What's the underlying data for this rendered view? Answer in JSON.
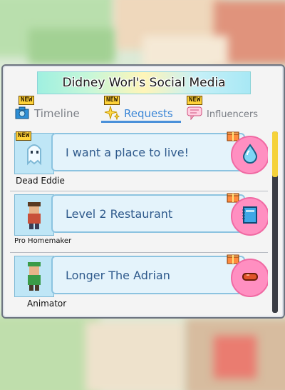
{
  "panel": {
    "title": "Didney Worl's Social Media"
  },
  "tabs": [
    {
      "label": "Timeline",
      "icon": "camera-icon",
      "new": "NEW",
      "active": false
    },
    {
      "label": "Requests",
      "icon": "sparkle-icon",
      "new": "NEW",
      "active": true
    },
    {
      "label": "Influencers",
      "icon": "speech-bubble-icon",
      "new": "NEW",
      "active": false
    }
  ],
  "requests": [
    {
      "name": "Dead Eddie",
      "text": "I want a place to live!",
      "new": "NEW",
      "reward_icon": "water-drop-icon"
    },
    {
      "name": "Pro Homemaker",
      "text": "Level 2 Restaurant",
      "new": "",
      "reward_icon": "notebook-icon"
    },
    {
      "name": "Animator",
      "text": "Longer The Adrian",
      "new": "",
      "reward_icon": "sausage-icon"
    }
  ],
  "colors": {
    "accent": "#4a90d9",
    "badge": "#ff8fc1",
    "scroll_thumb": "#f5d23a"
  }
}
